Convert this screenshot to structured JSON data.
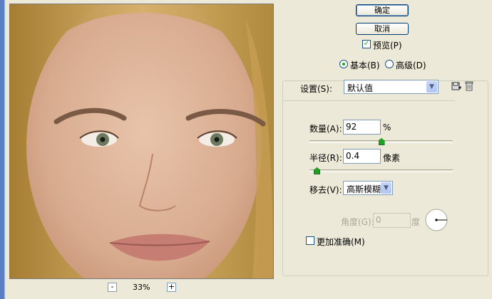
{
  "buttons": {
    "ok": "确定",
    "cancel": "取消"
  },
  "preview": {
    "label": "预览(P)",
    "checked": true
  },
  "mode": {
    "basic": "基本(B)",
    "advanced": "高级(D)",
    "selected": "basic"
  },
  "settings": {
    "label": "设置(S):",
    "value": "默认值"
  },
  "amount": {
    "label": "数量(A):",
    "value": "92",
    "unit": "%",
    "slider_fraction": 0.5
  },
  "radius": {
    "label": "半径(R):",
    "value": "0.4",
    "unit": "像素",
    "slider_fraction": 0.05
  },
  "remove": {
    "label": "移去(V):",
    "value": "高斯模糊"
  },
  "angle": {
    "label": "角度(G):",
    "value": "0",
    "unit": "度"
  },
  "more_accurate": {
    "label": "更加准确(M)",
    "checked": false
  },
  "zoom": {
    "minus": "-",
    "plus": "+",
    "value": "33%"
  },
  "icons": {
    "save_settings": "save-settings-icon",
    "delete_settings": "trash-icon",
    "dropdown": "chevron-down-icon"
  },
  "colors": {
    "accent_green": "#21a121",
    "dialog_bg": "#ece9d8",
    "border_blue": "#7f9db9"
  }
}
